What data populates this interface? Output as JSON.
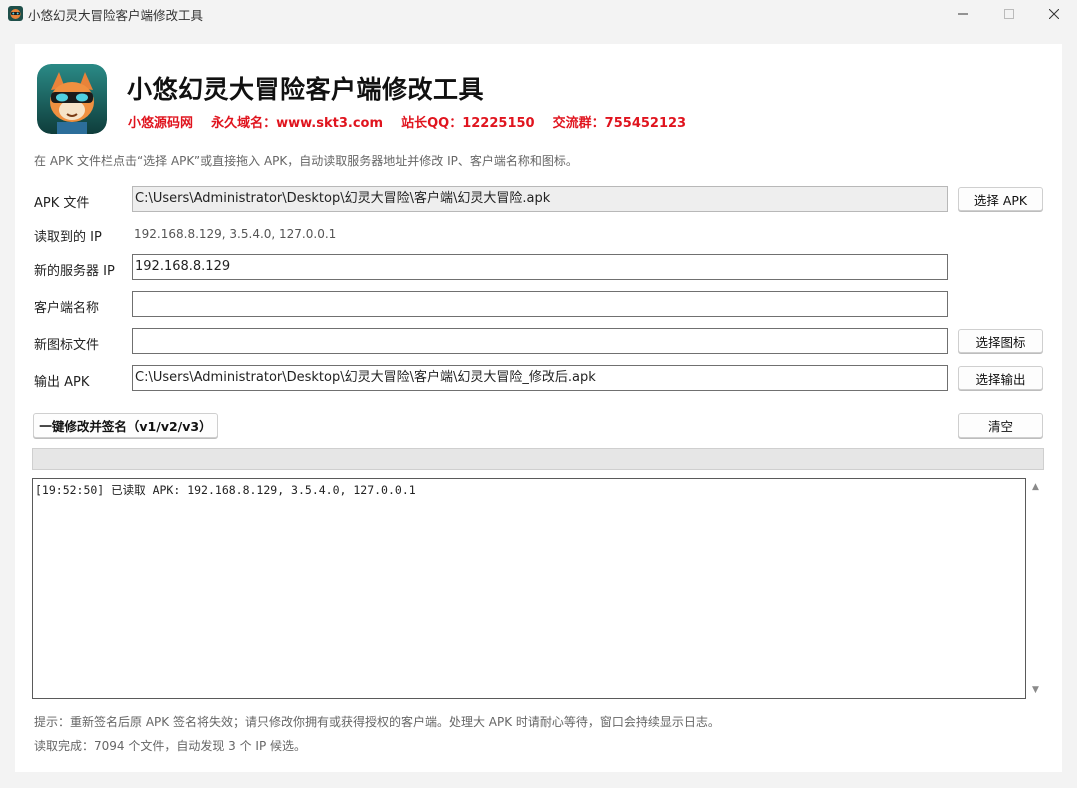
{
  "window": {
    "title": "小悠幻灵大冒险客户端修改工具",
    "minimize_icon": "minimize-icon",
    "maximize_icon": "maximize-icon",
    "close_icon": "close-icon"
  },
  "header": {
    "title": "小悠幻灵大冒险客户端修改工具",
    "subtitle": "小悠源码网    永久域名：www.skt3.com    站长QQ：12225150    交流群：755452123",
    "accent_color": "#e0141e"
  },
  "hint": "在 APK 文件栏点击“选择 APK”或直接拖入 APK，自动读取服务器地址并修改 IP、客户端名称和图标。",
  "form": {
    "apk_label": "APK 文件",
    "apk_value": "C:\\Users\\Administrator\\Desktop\\幻灵大冒险\\客户端\\幻灵大冒险.apk",
    "apk_button": "选择 APK",
    "ip_read_label": "读取到的 IP",
    "ip_read_value": "192.168.8.129, 3.5.4.0, 127.0.0.1",
    "new_ip_label": "新的服务器 IP",
    "new_ip_value": "192.168.8.129",
    "client_name_label": "客户端名称",
    "client_name_value": "",
    "icon_label": "新图标文件",
    "icon_value": "",
    "icon_button": "选择图标",
    "output_label": "输出 APK",
    "output_value": "C:\\Users\\Administrator\\Desktop\\幻灵大冒险\\客户端\\幻灵大冒险_修改后.apk",
    "output_button": "选择输出"
  },
  "actions": {
    "sign_button": "一键修改并签名（v1/v2/v3）",
    "clear_button": "清空"
  },
  "progress": {
    "value": 0
  },
  "log": {
    "lines": [
      "[19:52:50] 已读取 APK: 192.168.8.129, 3.5.4.0, 127.0.0.1"
    ]
  },
  "footer": {
    "tip": "提示：重新签名后原 APK 签名将失效；请只修改你拥有或获得授权的客户端。处理大 APK 时请耐心等待，窗口会持续显示日志。",
    "status": "读取完成：7094 个文件，自动发现 3 个 IP 候选。"
  }
}
